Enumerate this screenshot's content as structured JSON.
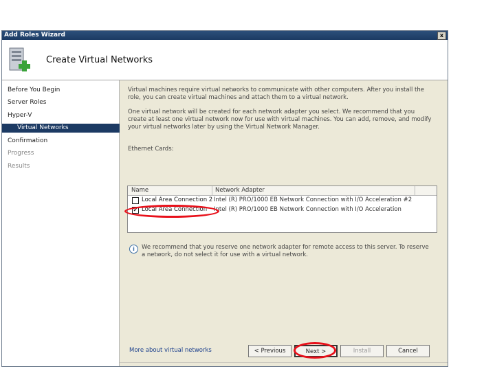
{
  "window": {
    "title": "Add Roles Wizard",
    "close_label": "x"
  },
  "header": {
    "title": "Create Virtual Networks"
  },
  "nav": {
    "items": [
      {
        "label": "Before You Begin"
      },
      {
        "label": "Server Roles"
      },
      {
        "label": "Hyper-V"
      },
      {
        "label": "Virtual Networks"
      },
      {
        "label": "Confirmation"
      },
      {
        "label": "Progress"
      },
      {
        "label": "Results"
      }
    ]
  },
  "main": {
    "intro": "Virtual machines require virtual networks to communicate with other computers. After you install the role, you can create virtual machines and attach them to a virtual network.",
    "instruction": "One virtual network will be created for each network adapter you select. We recommend that you create at least one virtual network now for use with virtual machines. You can add, remove, and modify your virtual networks later by using the Virtual Network Manager.",
    "list_label": "Ethernet Cards:",
    "columns": [
      "Name",
      "Network Adapter"
    ],
    "rows": [
      {
        "name": "Local Area Connection 2",
        "adapter": "Intel (R) PRO/1000 EB Network Connection with I/O Acceleration #2",
        "checked": false
      },
      {
        "name": "Local Area Connection",
        "adapter": "Intel (R) PRO/1000 EB Network Connection with I/O Acceleration",
        "checked": true
      }
    ],
    "info_text": "We recommend that you reserve one network adapter for remote access to this server. To reserve a network, do not select it for use with a virtual network.",
    "more_link": "More about virtual networks"
  },
  "buttons": {
    "previous": "< Previous",
    "next": "Next >",
    "install": "Install",
    "cancel": "Cancel"
  },
  "colors": {
    "annotation": "#e8101a",
    "nav_selected": "#1c3a63"
  }
}
